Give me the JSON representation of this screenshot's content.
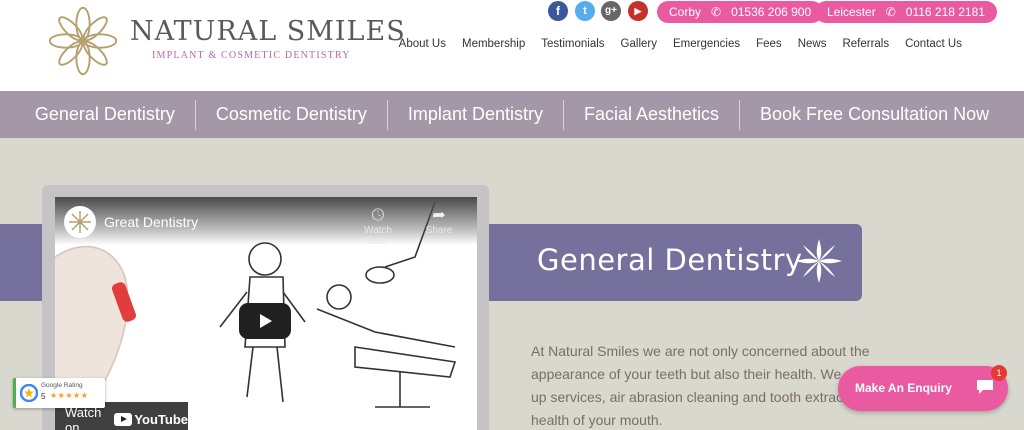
{
  "brand": {
    "name": "NATURAL SMILES",
    "tagline": "IMPLANT & COSMETIC DENTISTRY",
    "accent": "#ea5aa1",
    "logo_color": "#b3a06c"
  },
  "social": [
    {
      "icon": "facebook-icon",
      "glyph": "f",
      "color": "#3b5998"
    },
    {
      "icon": "twitter-icon",
      "glyph": "t",
      "color": "#55acee"
    },
    {
      "icon": "google-plus-icon",
      "glyph": "g+",
      "color": "#666666"
    },
    {
      "icon": "youtube-icon",
      "glyph": "▶",
      "color": "#c4302b"
    }
  ],
  "phones": [
    {
      "location": "Corby",
      "number": "01536 206 900"
    },
    {
      "location": "Leicester",
      "number": "0116 218 2181"
    }
  ],
  "top_nav": [
    "About Us",
    "Membership",
    "Testimonials",
    "Gallery",
    "Emergencies",
    "Fees",
    "News",
    "Referrals",
    "Contact Us"
  ],
  "main_nav": [
    "General Dentistry",
    "Cosmetic Dentistry",
    "Implant Dentistry",
    "Facial Aesthetics",
    "Book Free Consultation Now"
  ],
  "page": {
    "title": "General Dentistry",
    "intro": "At Natural Smiles we are not only concerned about the appearance of your teeth but also their health. We provide check-up services, air abrasion cleaning and tooth extraction for the good health of your mouth."
  },
  "video": {
    "title": "Great Dentistry",
    "watch_later": "Watch later",
    "share": "Share",
    "watch_on": "Watch on",
    "platform": "YouTube"
  },
  "google_rating": {
    "label": "Google Rating",
    "score": "5",
    "stars": "★★★★★"
  },
  "enquiry": {
    "label": "Make An Enquiry",
    "badge_count": "1"
  }
}
